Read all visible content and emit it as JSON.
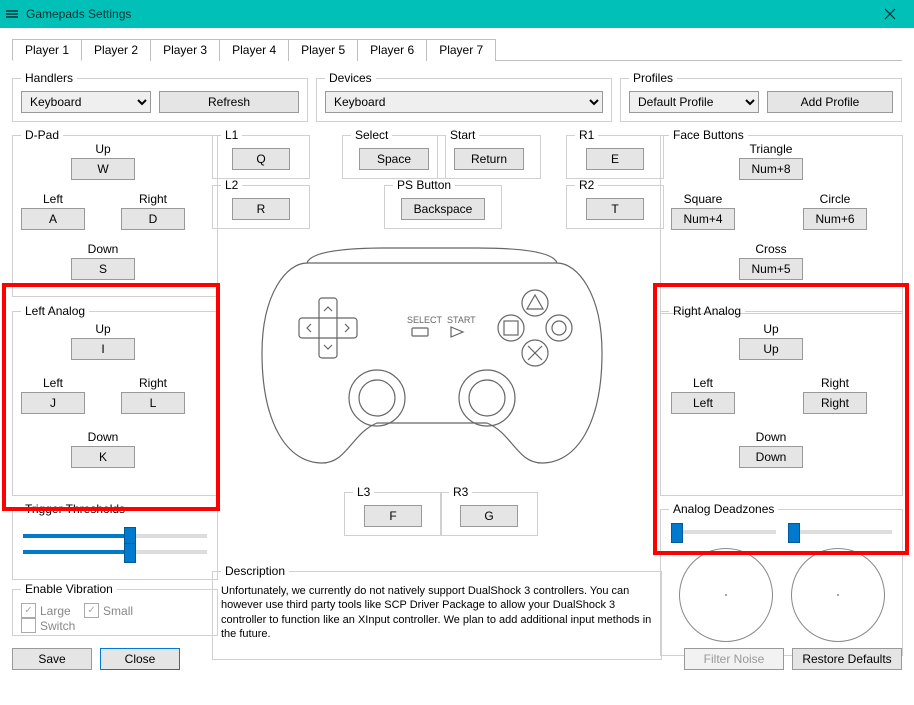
{
  "window": {
    "title": "Gamepads Settings"
  },
  "tabs": [
    {
      "label": "Player 1",
      "active": true
    },
    {
      "label": "Player 2"
    },
    {
      "label": "Player 3"
    },
    {
      "label": "Player 4"
    },
    {
      "label": "Player 5"
    },
    {
      "label": "Player 6"
    },
    {
      "label": "Player 7"
    }
  ],
  "handlers": {
    "legend": "Handlers",
    "value": "Keyboard",
    "refresh": "Refresh"
  },
  "devices": {
    "legend": "Devices",
    "value": "Keyboard"
  },
  "profiles": {
    "legend": "Profiles",
    "value": "Default Profile",
    "add": "Add Profile"
  },
  "dpad": {
    "legend": "D-Pad",
    "up": {
      "label": "Up",
      "value": "W"
    },
    "left": {
      "label": "Left",
      "value": "A"
    },
    "right": {
      "label": "Right",
      "value": "D"
    },
    "down": {
      "label": "Down",
      "value": "S"
    }
  },
  "l1": {
    "legend": "L1",
    "value": "Q"
  },
  "l2": {
    "legend": "L2",
    "value": "R"
  },
  "select": {
    "legend": "Select",
    "value": "Space"
  },
  "start": {
    "legend": "Start",
    "value": "Return"
  },
  "psbutton": {
    "legend": "PS Button",
    "value": "Backspace"
  },
  "r1": {
    "legend": "R1",
    "value": "E"
  },
  "r2": {
    "legend": "R2",
    "value": "T"
  },
  "faceButtons": {
    "legend": "Face Buttons",
    "triangle": {
      "label": "Triangle",
      "value": "Num+8"
    },
    "square": {
      "label": "Square",
      "value": "Num+4"
    },
    "circle": {
      "label": "Circle",
      "value": "Num+6"
    },
    "cross": {
      "label": "Cross",
      "value": "Num+5"
    }
  },
  "leftAnalog": {
    "legend": "Left Analog",
    "up": {
      "label": "Up",
      "value": "I"
    },
    "left": {
      "label": "Left",
      "value": "J"
    },
    "right": {
      "label": "Right",
      "value": "L"
    },
    "down": {
      "label": "Down",
      "value": "K"
    }
  },
  "rightAnalog": {
    "legend": "Right Analog",
    "up": {
      "label": "Up",
      "value": "Up"
    },
    "left": {
      "label": "Left",
      "value": "Left"
    },
    "right": {
      "label": "Right",
      "value": "Right"
    },
    "down": {
      "label": "Down",
      "value": "Down"
    }
  },
  "l3": {
    "legend": "L3",
    "value": "F"
  },
  "r3": {
    "legend": "R3",
    "value": "G"
  },
  "triggerThresholds": {
    "legend": "Trigger Thresholds"
  },
  "vibration": {
    "legend": "Enable Vibration",
    "large": "Large",
    "small": "Small",
    "switch": "Switch"
  },
  "description": {
    "legend": "Description",
    "text": "Unfortunately, we currently do not natively support DualShock 3 controllers. You can however use third party tools like SCP Driver Package to allow your DualShock 3 controller to function like an XInput controller. We plan to add additional input methods in the future."
  },
  "analogDeadzones": {
    "legend": "Analog Deadzones"
  },
  "buttons": {
    "save": "Save",
    "close": "Close",
    "filterNoise": "Filter Noise",
    "restoreDefaults": "Restore Defaults"
  }
}
